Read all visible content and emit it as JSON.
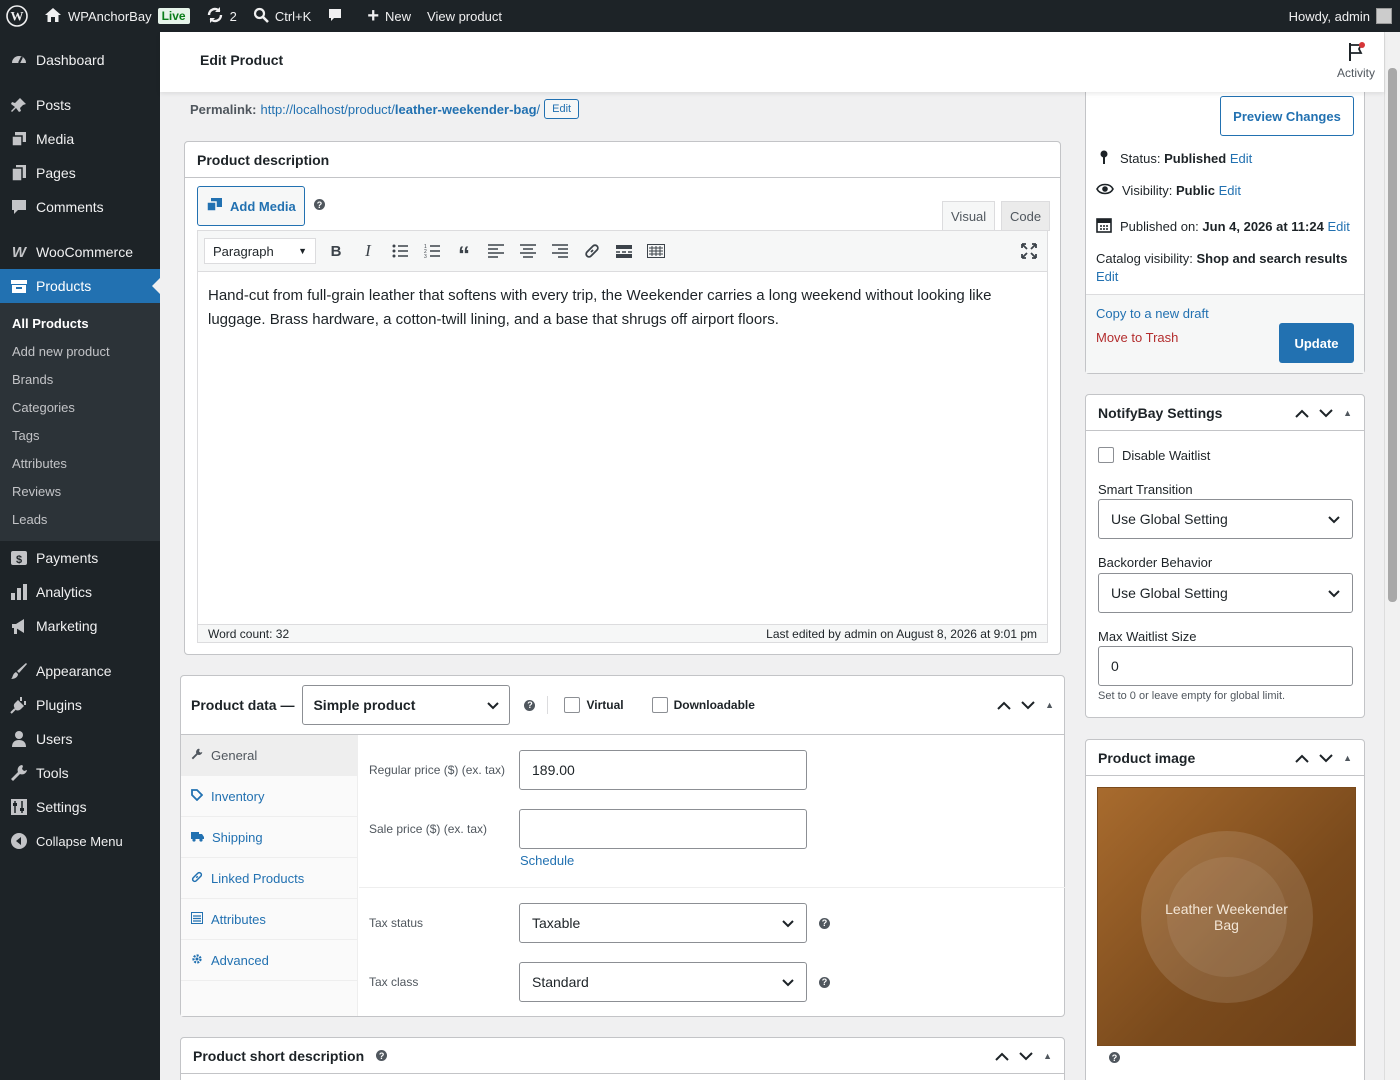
{
  "adminbar": {
    "site_name": "WPAnchorBay",
    "live_badge": "Live",
    "updates_count": "2",
    "search_shortcut": "Ctrl+K",
    "new_label": "New",
    "view_label": "View product",
    "howdy": "Howdy, admin"
  },
  "sidebar": {
    "items": [
      {
        "label": "Dashboard",
        "icon": "dashboard-icon"
      },
      {
        "label": "Posts",
        "icon": "pin-icon"
      },
      {
        "label": "Media",
        "icon": "media-icon"
      },
      {
        "label": "Pages",
        "icon": "pages-icon"
      },
      {
        "label": "Comments",
        "icon": "comment-icon"
      },
      {
        "label": "WooCommerce",
        "icon": "woo-icon"
      },
      {
        "label": "Products",
        "icon": "archive-icon"
      },
      {
        "label": "Payments",
        "icon": "dollar-icon"
      },
      {
        "label": "Analytics",
        "icon": "chart-icon"
      },
      {
        "label": "Marketing",
        "icon": "megaphone-icon"
      },
      {
        "label": "Appearance",
        "icon": "brush-icon"
      },
      {
        "label": "Plugins",
        "icon": "plug-icon"
      },
      {
        "label": "Users",
        "icon": "user-icon"
      },
      {
        "label": "Tools",
        "icon": "wrench-icon"
      },
      {
        "label": "Settings",
        "icon": "settings-icon"
      },
      {
        "label": "Collapse Menu",
        "icon": "collapse-icon"
      }
    ],
    "submenu": [
      "All Products",
      "Add new product",
      "Brands",
      "Categories",
      "Tags",
      "Attributes",
      "Reviews",
      "Leads"
    ]
  },
  "header": {
    "title": "Edit Product",
    "activity": "Activity"
  },
  "permalink": {
    "label": "Permalink:",
    "url_base": "http://localhost/product/",
    "slug": "leather-weekender-bag",
    "url_end": "/",
    "edit": "Edit"
  },
  "description": {
    "title": "Product description",
    "add_media": "Add Media",
    "tab_visual": "Visual",
    "tab_code": "Code",
    "format": "Paragraph",
    "content": "Hand-cut from full-grain leather that softens with every trip, the Weekender carries a long weekend without looking like luggage. Brass hardware, a cotton-twill lining, and a base that shrugs off airport floors.",
    "word_count": "Word count: 32",
    "last_edited": "Last edited by admin on August 8, 2026 at 9:01 pm"
  },
  "product_data": {
    "title": "Product data —",
    "type": "Simple product",
    "virtual": "Virtual",
    "downloadable": "Downloadable",
    "tabs": [
      {
        "label": "General",
        "icon": "wrench-icon"
      },
      {
        "label": "Inventory",
        "icon": "tag-icon"
      },
      {
        "label": "Shipping",
        "icon": "truck-icon"
      },
      {
        "label": "Linked Products",
        "icon": "link-icon"
      },
      {
        "label": "Attributes",
        "icon": "list-icon"
      },
      {
        "label": "Advanced",
        "icon": "gear-icon"
      }
    ],
    "regular_price_label": "Regular price ($) (ex. tax)",
    "regular_price": "189.00",
    "sale_price_label": "Sale price ($) (ex. tax)",
    "sale_price": "",
    "schedule": "Schedule",
    "tax_status_label": "Tax status",
    "tax_status": "Taxable",
    "tax_class_label": "Tax class",
    "tax_class": "Standard"
  },
  "short_description": {
    "title": "Product short description"
  },
  "publish": {
    "preview": "Preview Changes",
    "status_label": "Status:",
    "status": "Published",
    "visibility_label": "Visibility:",
    "visibility": "Public",
    "published_label": "Published on:",
    "published": "Jun 4, 2026 at 11:24",
    "catalog_label": "Catalog visibility:",
    "catalog": "Shop and search results",
    "edit": "Edit",
    "copy_draft": "Copy to a new draft",
    "trash": "Move to Trash",
    "update": "Update"
  },
  "notifybay": {
    "title": "NotifyBay Settings",
    "disable_waitlist": "Disable Waitlist",
    "smart_transition_label": "Smart Transition",
    "smart_transition": "Use Global Setting",
    "backorder_label": "Backorder Behavior",
    "backorder": "Use Global Setting",
    "max_label": "Max Waitlist Size",
    "max_value": "0",
    "max_hint": "Set to 0 or leave empty for global limit."
  },
  "product_image": {
    "title": "Product image",
    "image_text": "Leather Weekender Bag"
  },
  "colors": {
    "accent": "#2271b1",
    "sidebar": "#1d2327",
    "danger": "#b32d2e"
  }
}
